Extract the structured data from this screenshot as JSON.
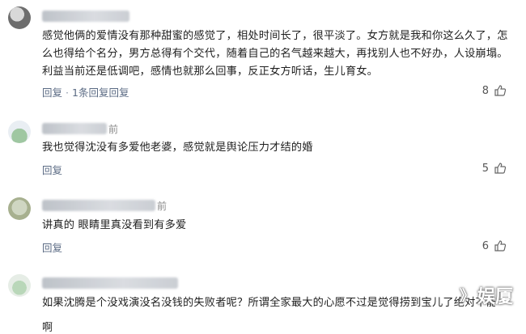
{
  "comments": [
    {
      "name_tail": "",
      "text": "感觉他俩的爱情没有那种甜蜜的感觉了，相处时间长了，很平淡了。女方就是我和你这么久了，怎么也得给个名分，男方总得有个交代，随着自己的名气越来越大，再找别人也不好办，人设崩塌。利益当前还是低调吧，感情也就那么回事，反正女方听话，生儿育女。",
      "reply_label": "回复",
      "more_replies": "1条回复",
      "likes": "8"
    },
    {
      "name_tail": "前",
      "text": "我也觉得沈没有多爱他老婆，感觉就是舆论压力才结的婚",
      "reply_label": "回复",
      "likes": "5"
    },
    {
      "name_tail": "前",
      "text": "讲真的 眼睛里真没看到有多爱",
      "reply_label": "回复",
      "likes": "6"
    },
    {
      "name_tail": "",
      "text": "如果沈腾是个没戏演没名没钱的失败者呢？所谓全家最大的心愿不过是觉得捞到宝儿了绝对不能松手",
      "trailing": "啊"
    }
  ],
  "watermark": {
    "mark": "》",
    "text": "娱厦"
  }
}
